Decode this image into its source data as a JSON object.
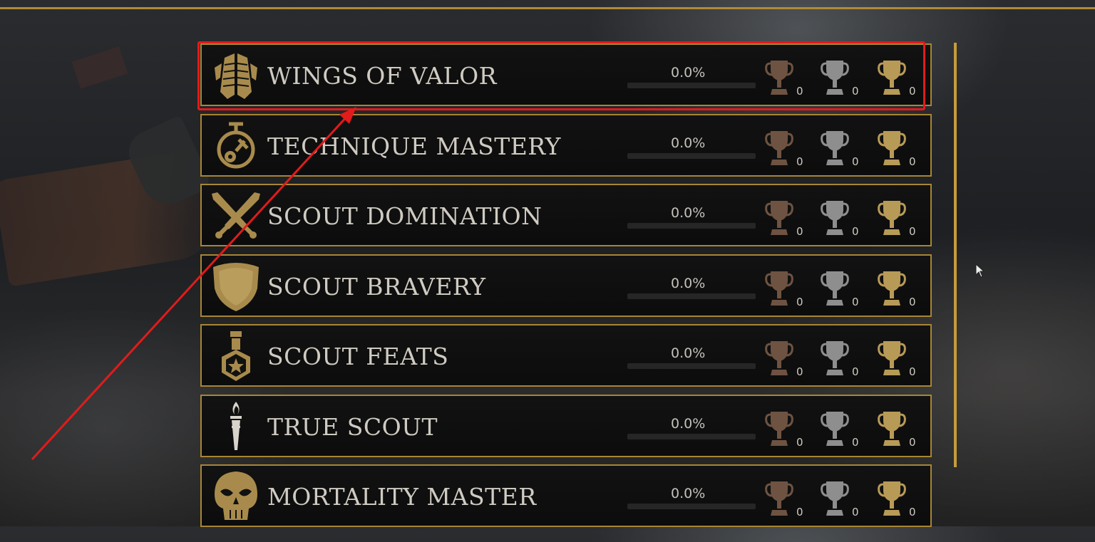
{
  "colors": {
    "gold": "#a88535",
    "bronze": "#6e5342",
    "silver": "#8e8e8e",
    "goldTrophy": "#b89a57",
    "highlight": "#e21b1b"
  },
  "categories": [
    {
      "title": "WINGS OF VALOR",
      "percent": "0.0%",
      "progress": 0,
      "icon": "wings-emblem-icon",
      "bronze": "0",
      "silver": "0",
      "gold": "0"
    },
    {
      "title": "TECHNIQUE MASTERY",
      "percent": "0.0%",
      "progress": 0,
      "icon": "stopwatch-gear-icon",
      "bronze": "0",
      "silver": "0",
      "gold": "0"
    },
    {
      "title": "SCOUT DOMINATION",
      "percent": "0.0%",
      "progress": 0,
      "icon": "crossed-swords-icon",
      "bronze": "0",
      "silver": "0",
      "gold": "0"
    },
    {
      "title": "SCOUT BRAVERY",
      "percent": "0.0%",
      "progress": 0,
      "icon": "shield-icon",
      "bronze": "0",
      "silver": "0",
      "gold": "0"
    },
    {
      "title": "SCOUT FEATS",
      "percent": "0.0%",
      "progress": 0,
      "icon": "medal-icon",
      "bronze": "0",
      "silver": "0",
      "gold": "0"
    },
    {
      "title": "TRUE SCOUT",
      "percent": "0.0%",
      "progress": 0,
      "icon": "torch-icon",
      "bronze": "0",
      "silver": "0",
      "gold": "0"
    },
    {
      "title": "MORTALITY MASTER",
      "percent": "0.0%",
      "progress": 0,
      "icon": "skull-icon",
      "bronze": "0",
      "silver": "0",
      "gold": "0"
    }
  ]
}
